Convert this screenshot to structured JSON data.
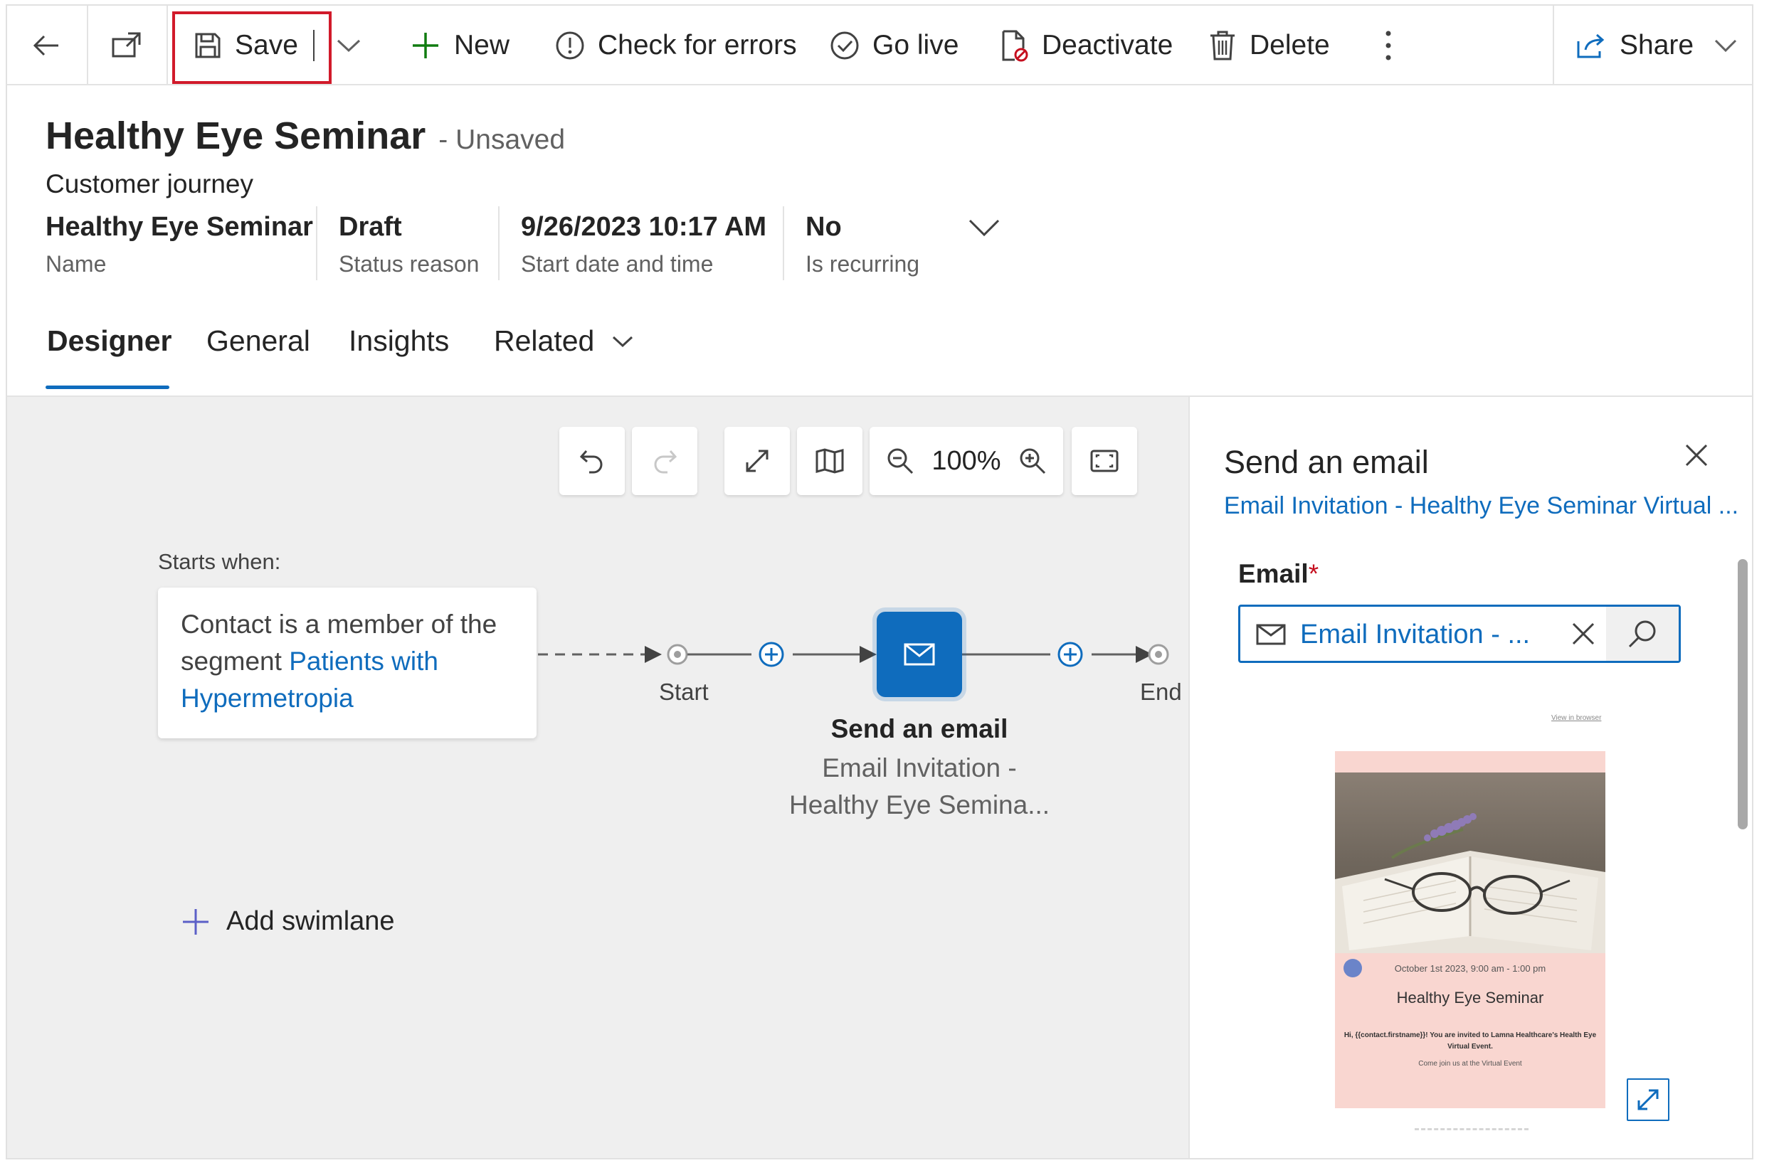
{
  "toolbar": {
    "save": "Save",
    "new": "New",
    "check_for_errors": "Check for errors",
    "go_live": "Go live",
    "deactivate": "Deactivate",
    "delete": "Delete",
    "share": "Share"
  },
  "header": {
    "title": "Healthy Eye Seminar",
    "unsaved": "- Unsaved",
    "entity_type": "Customer journey",
    "fields": [
      {
        "value": "Healthy Eye Seminar",
        "label": "Name"
      },
      {
        "value": "Draft",
        "label": "Status reason"
      },
      {
        "value": "9/26/2023 10:17 AM",
        "label": "Start date and time"
      },
      {
        "value": "No",
        "label": "Is recurring"
      }
    ]
  },
  "tabs": [
    "Designer",
    "General",
    "Insights",
    "Related"
  ],
  "active_tab": "Designer",
  "canvas": {
    "zoom": "100%",
    "starts_when": "Starts when:",
    "trigger_text_1": "Contact is a member of the",
    "trigger_text_2": "segment",
    "trigger_link": "Patients with Hypermetropia",
    "start_label": "Start",
    "end_label": "End",
    "node_title": "Send an email",
    "node_sub_1": "Email Invitation -",
    "node_sub_2": "Healthy Eye Semina...",
    "add_swimlane": "Add swimlane"
  },
  "panel": {
    "title": "Send an email",
    "link": "Email Invitation - Healthy Eye Seminar Virtual ...",
    "email_label": "Email",
    "required_mark": "*",
    "email_value": "Email Invitation - ...",
    "preview": {
      "view_link": "View in browser",
      "date": "October 1st 2023, 9:00 am - 1:00 pm",
      "title": "Healthy Eye Seminar",
      "body": "Hi, {{contact.firstname}}! You are invited to Lamna Healthcare's Health Eye Virtual Event.",
      "footer": "Come join us at the Virtual Event"
    }
  },
  "colors": {
    "accent": "#0f6cbd",
    "highlight_border": "#d11a2a",
    "canvas_bg": "#efefef",
    "preview_bg": "#f9d6d0"
  }
}
